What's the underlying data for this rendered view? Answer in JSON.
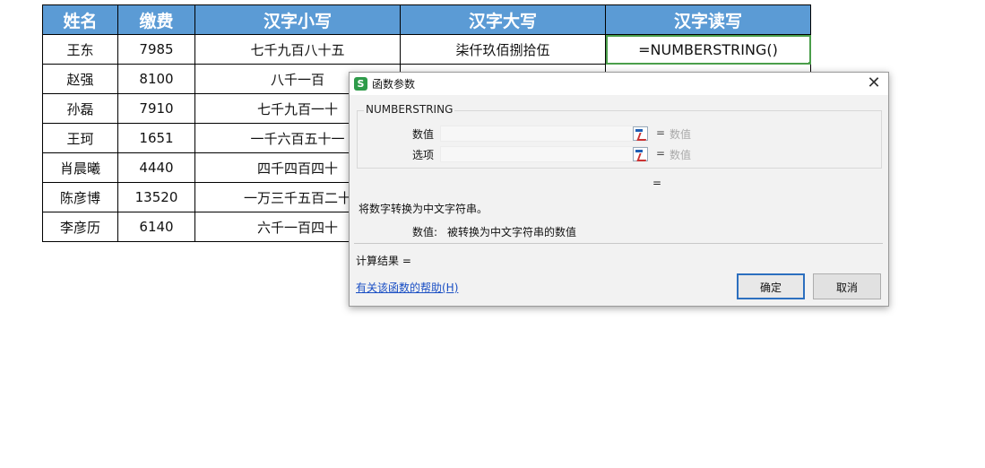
{
  "sheet": {
    "headers": [
      "姓名",
      "缴费",
      "汉字小写",
      "汉字大写",
      "汉字读写"
    ],
    "rows": [
      [
        "王东",
        "7985",
        "七千九百八十五",
        "柒仟玖佰捌拾伍",
        "=NUMBERSTRING()"
      ],
      [
        "赵强",
        "8100",
        "八千一百",
        "",
        ""
      ],
      [
        "孙磊",
        "7910",
        "七千九百一十",
        "",
        ""
      ],
      [
        "王珂",
        "1651",
        "一千六百五十一",
        "",
        ""
      ],
      [
        "肖晨曦",
        "4440",
        "四千四百四十",
        "",
        ""
      ],
      [
        "陈彦博",
        "13520",
        "一万三千五百二十",
        "",
        ""
      ],
      [
        "李彦历",
        "6140",
        "六千一百四十",
        "",
        ""
      ]
    ]
  },
  "dialog": {
    "app_icon_letter": "S",
    "title": "函数参数",
    "close_glyph": "✕",
    "function_name": "NUMBERSTRING",
    "args": [
      {
        "label": "数值",
        "value": "",
        "eq": "=",
        "hint": "数值"
      },
      {
        "label": "选项",
        "value": "",
        "eq": "=",
        "hint": "数值"
      }
    ],
    "result_eq": "=",
    "description": "将数字转换为中文字符串。",
    "param_desc_name": "数值:",
    "param_desc_text": "被转换为中文字符串的数值",
    "calc_result_label": "计算结果 =",
    "help_link": "有关该函数的帮助(H)",
    "ok_label": "确定",
    "cancel_label": "取消"
  },
  "colors": {
    "header_bg": "#5b9bd5",
    "active_cell_border": "#4a9e4a",
    "app_icon": "#2e9b4a",
    "ok_border": "#2c6fbf",
    "link": "#1a4fc4"
  }
}
